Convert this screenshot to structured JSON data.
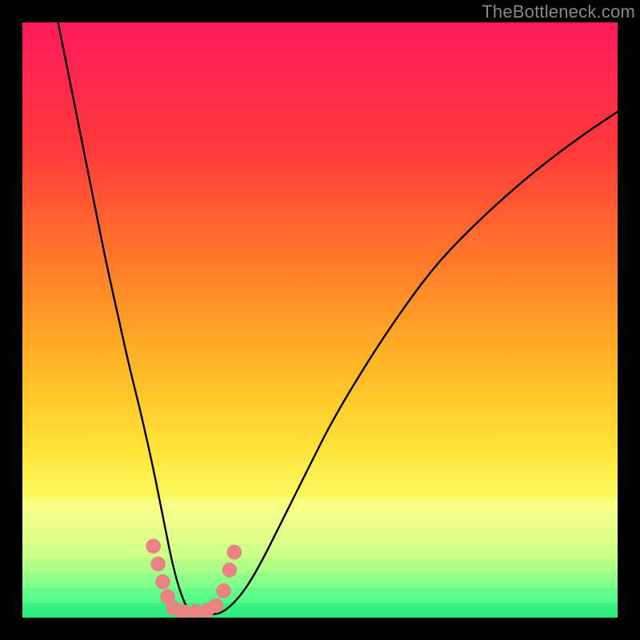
{
  "watermark": "TheBottleneck.com",
  "chart_data": {
    "type": "line",
    "title": "",
    "xlabel": "",
    "ylabel": "",
    "xlim": [
      0,
      100
    ],
    "ylim": [
      0,
      100
    ],
    "gradient_stops": [
      {
        "offset": 0,
        "color": "#ff1a5b"
      },
      {
        "offset": 22,
        "color": "#ff3b3b"
      },
      {
        "offset": 40,
        "color": "#ff7a2a"
      },
      {
        "offset": 58,
        "color": "#ffb825"
      },
      {
        "offset": 72,
        "color": "#ffe43a"
      },
      {
        "offset": 82,
        "color": "#faff6a"
      },
      {
        "offset": 90,
        "color": "#d2ff7a"
      },
      {
        "offset": 96,
        "color": "#63ff8f"
      },
      {
        "offset": 100,
        "color": "#1fe67a"
      }
    ],
    "series": [
      {
        "name": "bottleneck-curve",
        "x": [
          6,
          8,
          10,
          12,
          14,
          16,
          18,
          20,
          22,
          23,
          24,
          25,
          26,
          27,
          28,
          30,
          32,
          34,
          37,
          40,
          44,
          48,
          52,
          58,
          64,
          70,
          78,
          86,
          94,
          100
        ],
        "y": [
          100,
          90,
          80,
          70,
          60,
          51,
          42,
          34,
          25,
          20,
          15,
          10,
          6,
          3,
          1,
          0.5,
          0.5,
          1,
          4,
          9,
          17,
          25,
          33,
          43,
          52,
          60,
          68,
          75,
          81,
          85
        ]
      }
    ],
    "markers": {
      "name": "highlight-cluster",
      "color": "#e98282",
      "radius_pct": 1.25,
      "points": [
        {
          "x": 22.0,
          "y": 12.0
        },
        {
          "x": 22.8,
          "y": 9.0
        },
        {
          "x": 23.6,
          "y": 6.0
        },
        {
          "x": 24.4,
          "y": 3.5
        },
        {
          "x": 25.4,
          "y": 1.6
        },
        {
          "x": 27.0,
          "y": 1.0
        },
        {
          "x": 29.0,
          "y": 1.0
        },
        {
          "x": 31.0,
          "y": 1.2
        },
        {
          "x": 32.5,
          "y": 2.0
        },
        {
          "x": 33.8,
          "y": 4.5
        },
        {
          "x": 34.8,
          "y": 8.0
        },
        {
          "x": 35.6,
          "y": 11.0
        }
      ]
    }
  }
}
